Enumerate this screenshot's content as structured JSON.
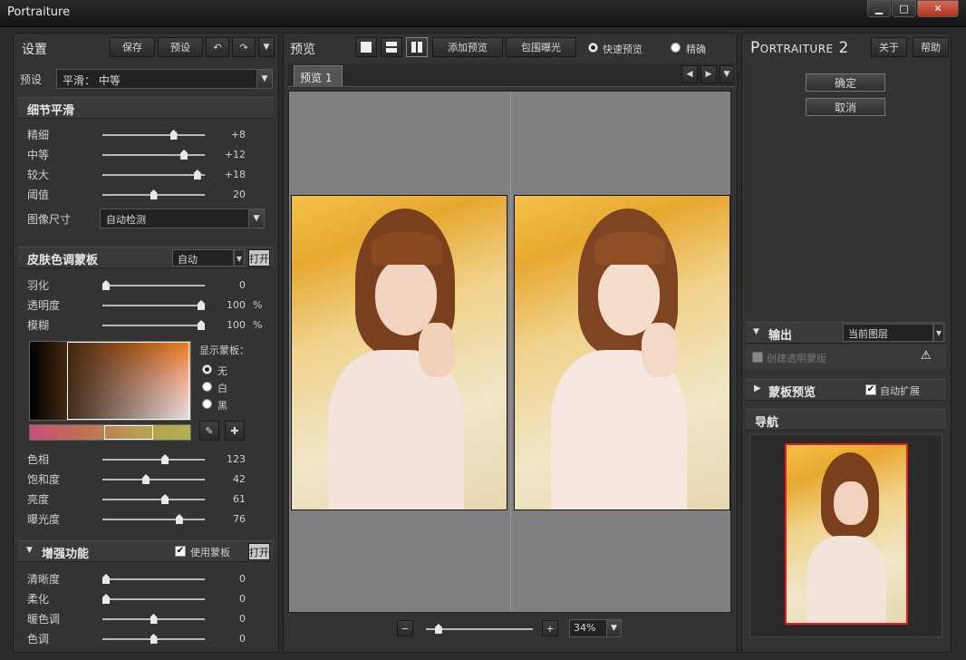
{
  "window": {
    "title": "Portraiture",
    "min": "▁",
    "max": "□",
    "close": "✕"
  },
  "left": {
    "title": "设置",
    "save": "保存",
    "preset_btn": "预设",
    "preset_label": "预设",
    "preset_value": "平滑： 中等",
    "detail": {
      "title": "细节平滑",
      "sliders": [
        {
          "label": "精细",
          "value": "+8",
          "pos": 0.71
        },
        {
          "label": "中等",
          "value": "+12",
          "pos": 0.82
        },
        {
          "label": "较大",
          "value": "+18",
          "pos": 0.96
        },
        {
          "label": "阈值",
          "value": "20",
          "pos": 0.5
        }
      ],
      "image_size_label": "图像尺寸",
      "image_size_value": "自动检测"
    },
    "skin": {
      "title": "皮肤色调蒙板",
      "mode": "自动",
      "open": "打开",
      "sliders": [
        {
          "label": "羽化",
          "value": "0",
          "pos": 0.0,
          "unit": ""
        },
        {
          "label": "透明度",
          "value": "100",
          "pos": 1.0,
          "unit": "%"
        },
        {
          "label": "模糊",
          "value": "100",
          "pos": 1.0,
          "unit": "%"
        }
      ],
      "show_mask": "显示蒙板：",
      "mask_options": [
        "无",
        "白",
        "黑"
      ],
      "sliders2": [
        {
          "label": "色相",
          "value": "123",
          "pos": 0.62
        },
        {
          "label": "饱和度",
          "value": "42",
          "pos": 0.42
        },
        {
          "label": "亮度",
          "value": "61",
          "pos": 0.62
        },
        {
          "label": "曝光度",
          "value": "76",
          "pos": 0.77
        }
      ]
    },
    "enhance": {
      "title": "增强功能",
      "use_mask": "使用蒙板",
      "open": "打开",
      "sliders": [
        {
          "label": "清晰度",
          "value": "0",
          "pos": 0.0
        },
        {
          "label": "柔化",
          "value": "0",
          "pos": 0.0
        },
        {
          "label": "暖色调",
          "value": "0",
          "pos": 0.5
        },
        {
          "label": "色调",
          "value": "0",
          "pos": 0.5
        }
      ]
    }
  },
  "center": {
    "title": "预览",
    "add_preview": "添加预览",
    "bracket": "包围曝光",
    "quick_preview": "快速预览",
    "precise": "精确",
    "tab": "预览 1",
    "zoom": "34%",
    "zoom_level": 0.09,
    "minus": "−",
    "plus": "+"
  },
  "right": {
    "title": "Portraiture 2",
    "about": "关于",
    "help": "帮助",
    "ok": "确定",
    "cancel": "取消",
    "output_title": "输出",
    "output_value": "当前图层",
    "transparent_mask": "创建透明蒙版",
    "mask_preview": "蒙板预览",
    "auto_expand": "自动扩展",
    "navigator": "导航"
  }
}
